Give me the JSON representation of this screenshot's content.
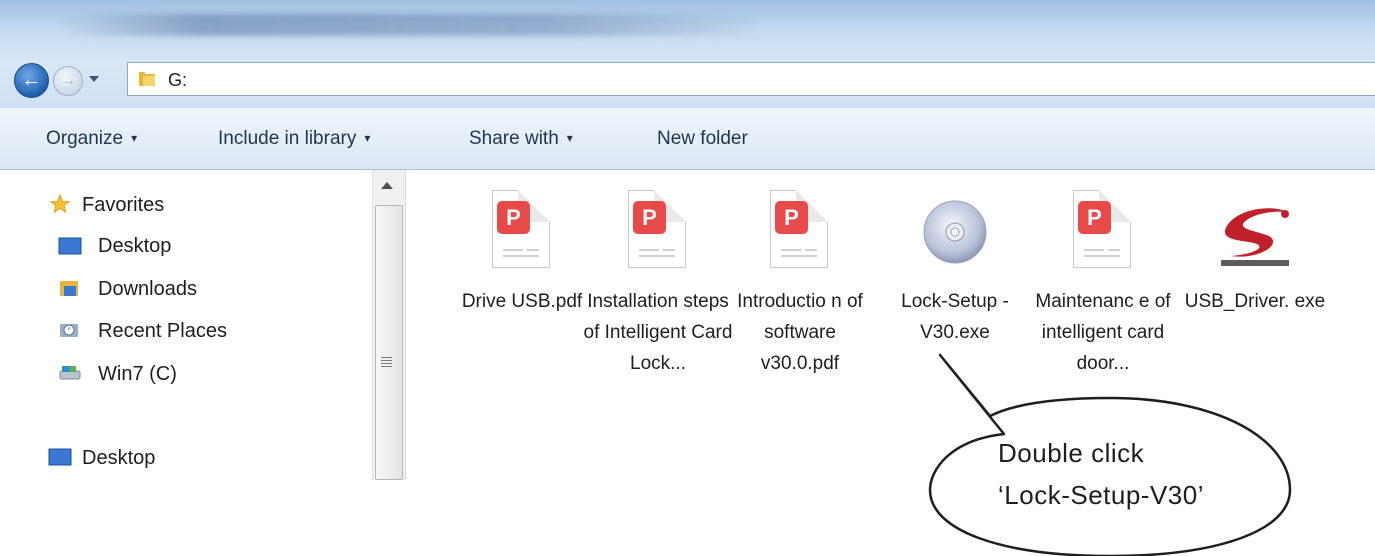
{
  "address": {
    "path": "G:",
    "folder_icon": "folder-icon"
  },
  "toolbar": {
    "organize": "Organize",
    "include_in_library": "Include in library",
    "share_with": "Share with",
    "new_folder": "New folder",
    "caret": "▾"
  },
  "nav": {
    "favorites": "Favorites",
    "desktop": "Desktop",
    "downloads": "Downloads",
    "recent_places": "Recent Places",
    "win7": "Win7 (C)",
    "desktop2": "Desktop"
  },
  "files": [
    {
      "label": "Drive USB.pdf",
      "type": "pdf",
      "badge": "P"
    },
    {
      "label": "Installation steps of Intelligent Card Lock...",
      "type": "pdf",
      "badge": "P"
    },
    {
      "label": "Introductio n of software v30.0.pdf",
      "type": "pdf",
      "badge": "P"
    },
    {
      "label": "Lock-Setup -V30.exe",
      "type": "setup-disc"
    },
    {
      "label": "Maintenanc e of intelligent card door...",
      "type": "pdf",
      "badge": "P"
    },
    {
      "label": "USB_Driver. exe",
      "type": "silicon-labs"
    }
  ],
  "callout": {
    "line1": "Double click",
    "line2": "‘Lock-Setup-V30’"
  },
  "colors": {
    "accent": "#1f5fae",
    "pdf_badge": "#e84a4a",
    "logo": "#c0202a"
  }
}
